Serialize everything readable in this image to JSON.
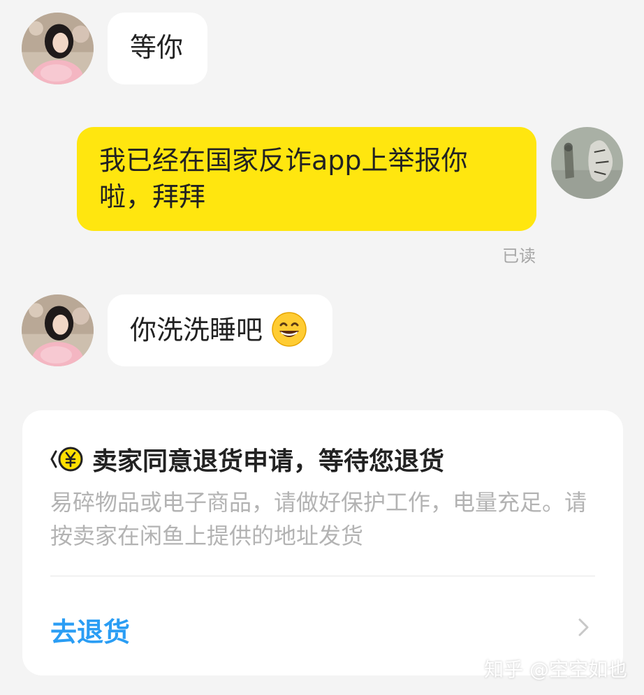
{
  "messages": [
    {
      "side": "left",
      "text": "等你",
      "avatar": "contact-avatar"
    },
    {
      "side": "right",
      "lines": [
        "我已经在国家反诈app上举报你",
        "啦，拜拜"
      ],
      "avatar": "user-avatar",
      "status": "已读"
    },
    {
      "side": "left",
      "text": "你洗洗睡吧",
      "emoji": "grinning-face-emoji",
      "avatar": "contact-avatar"
    }
  ],
  "card": {
    "icon": "yen-return-icon",
    "title": "卖家同意退货申请，等待您退货",
    "description": "易碎物品或电子商品，请做好保护工作，电量充足。请按卖家在闲鱼上提供的地址发货",
    "action_label": "去退货",
    "action_icon": "chevron-right-icon"
  },
  "watermark": "知乎 @空空如也",
  "colors": {
    "background": "#f4f4f4",
    "bubble_right": "#ffe60f",
    "bubble_left": "#ffffff",
    "action": "#2a9df4"
  }
}
